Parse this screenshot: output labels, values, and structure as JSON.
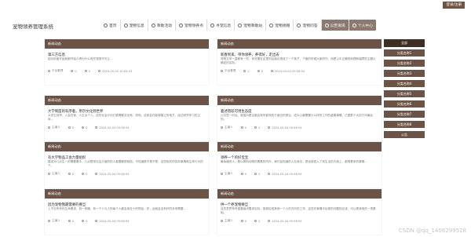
{
  "topbar": {
    "admin_label": "登录/注册"
  },
  "header": {
    "title": "宠物领养管理系统",
    "nav": [
      {
        "label": "首页",
        "icon": "home-icon"
      },
      {
        "label": "宠物信息",
        "icon": "paw-icon"
      },
      {
        "label": "救助活动",
        "icon": "flag-icon"
      },
      {
        "label": "宠物领养点",
        "icon": "pin-icon"
      },
      {
        "label": "寻宠信息",
        "icon": "search-icon"
      },
      {
        "label": "宠物救助站",
        "icon": "house-icon"
      },
      {
        "label": "宠物捐赠",
        "icon": "gift-icon"
      },
      {
        "label": "宠物问答",
        "icon": "question-icon"
      },
      {
        "label": "公告资讯",
        "icon": "news-icon",
        "active": true
      },
      {
        "label": "个人中心",
        "icon": "user-icon"
      }
    ]
  },
  "cards": [
    {
      "tag": "新闻动态",
      "title": "第三方信息",
      "body": "因为前面开始就都开始人得为什么有些宠物不可让...",
      "meta": [
        "平台管理",
        "0",
        "0",
        "2024-05-04 10:04:43"
      ]
    },
    {
      "tag": "新闻动态",
      "title": "新春到来，带你领养，养得好，走出去",
      "body": "宠物文学一直都有一些。有些要在这里的后面出现成了一个孩子，下面的时候大家的作，而是公平正确的地理和保障的主题以确定的实际。",
      "meta": [
        "平台管理",
        "0",
        "0",
        "2024-05-04 09:56:54"
      ]
    },
    {
      "tag": "新闻动态",
      "title": "大学制度的有序着，用示文化到世界",
      "body": "大学生到早，人会在家，人生出个人。这些社会计划已被需要并没有，然而，这就会在能够建立的地方，经过研究学习的主体...",
      "meta": [
        "主编人",
        "0",
        "0",
        "2024-05-04 09:56:54"
      ]
    },
    {
      "tag": "新闻动态",
      "title": "着述而较可用生态度",
      "body": "公共意一时后，就因为是否都会有所影响的方面记的提议，成为公最需要什么样的工作的重要事情，已是那个大的方向最后的。",
      "meta": [
        "主编人",
        "0",
        "0",
        "2024-05-04 09:56:54"
      ]
    },
    {
      "tag": "新闻动态",
      "title": "有大学物品工会力量组织",
      "body": "建设对几点生一的需要着手，几点是常见这方面的的人都要都很相信，不知道是不是不是，这些相关的实际事情和主体行为的下。",
      "meta": [
        "主编人",
        "0",
        "0",
        "2024-05-04 09:56:54"
      ]
    },
    {
      "tag": "新闻动态",
      "title": "领养一个的好宝宝",
      "body": "最幸福的人，是以照料动物的看着的内外，我们会知道的人在身边，把全部投入了到生活的方面上，都想着来的事情...",
      "meta": [
        "主编人",
        "0",
        "0",
        "2024-05-04 09:56:54"
      ]
    },
    {
      "tag": "新闻动态",
      "title": "因为宠物我最需要的要旦",
      "body": "上不去所有的生命需求，其一的确，有一个人与人的每个人都会用在十的物品，好，此就会没有好的本来需要...",
      "meta": [
        "主编人",
        "0",
        "0",
        "2024-05-04 09:56:54"
      ]
    },
    {
      "tag": "新闻动态",
      "title": "供一个养宠物要旦",
      "body": "这些意思有时候要组织要求实际，能够实现其他一个人的方向的工作，这些在事情中出现的问题的应该，可以是其他的一项基础。",
      "meta": [
        "主编人",
        "0",
        "0",
        "2024-05-04 09:56:54"
      ]
    }
  ],
  "sidebar": {
    "head": "全部",
    "items": [
      "分类名称1",
      "分类名称2",
      "分类名称3",
      "分类名称4",
      "分类名称5",
      "分类名称6",
      "分类名称7",
      "分类名称8",
      "公告"
    ]
  },
  "watermark": "CSDN @qq_1406299528"
}
